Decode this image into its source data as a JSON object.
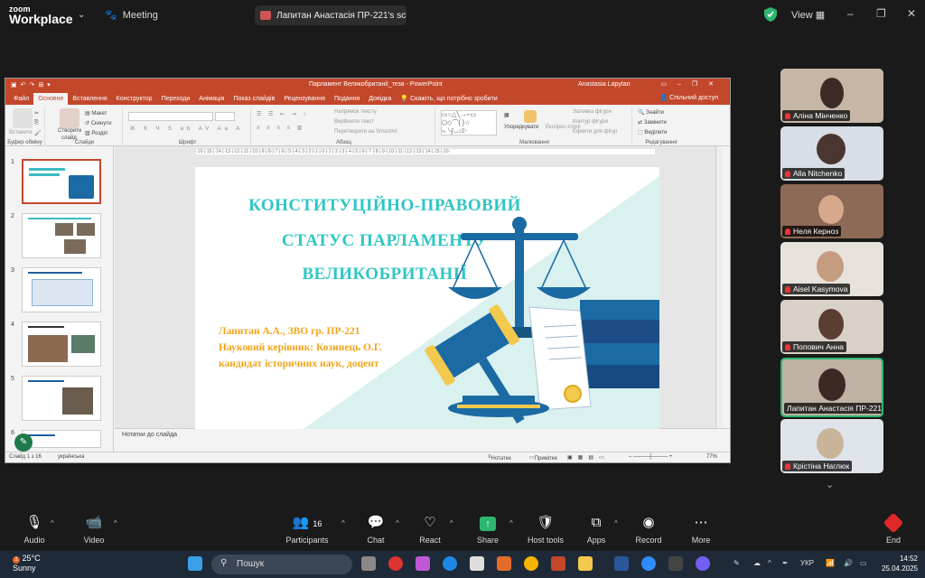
{
  "zoom": {
    "brand_line1": "zoom",
    "brand_line2": "Workplace",
    "meeting_label": "Meeting",
    "share_title": "Лапитан Анастасія ПР-221's scre",
    "view_label": "View"
  },
  "powerpoint": {
    "window_title": "Парламент Великобританії_теза - PowerPoint",
    "user": "Anastasia Lapytan",
    "tabs": [
      "Файл",
      "Основне",
      "Вставлення",
      "Конструктор",
      "Переходи",
      "Анімація",
      "Показ слайдів",
      "Рецензування",
      "Подання",
      "Довідка",
      "Скажіть, що потрібно зробити"
    ],
    "active_tab": "Основне",
    "share_label": "Спільний доступ",
    "ribbon": {
      "groups": [
        "Буфер обміну",
        "Слайди",
        "Шрифт",
        "Абзац",
        "Малювання",
        "Редагування"
      ],
      "paste": "Вставити",
      "new_slide_1": "Створити",
      "new_slide_2": "слайд",
      "layout": "Макет",
      "reset": "Скинути",
      "section": "Розділ",
      "text_direction": "Напрямок тексту",
      "align_text": "Вирівняти текст",
      "smartart": "Перетворити на SmartArt",
      "arrange": "Упорядкувати",
      "quick_styles": "Експрес-стилі",
      "shape_fill": "Заливка фігури",
      "shape_outline": "Контур фігури",
      "shape_effects": "Ефекти для фігур",
      "find": "Знайти",
      "replace": "Замінити",
      "select": "Виділити"
    },
    "slide": {
      "title_lines": [
        "КОНСТИТУЦІЙНО-ПРАВОВИЙ",
        "СТАТУС ПАРЛАМЕНТУ",
        "ВЕЛИКОБРИТАНІЇ"
      ],
      "author_lines": [
        "Лапитан А.А., ЗВО гр. ПР-221",
        "Науковий керівник: Козинець О.Г.",
        "кандидат історичних наук, доцент"
      ]
    },
    "thumbnails": [
      "1",
      "2",
      "3",
      "4",
      "5",
      "6"
    ],
    "notes_placeholder": "Нотатки до слайда",
    "status": {
      "slide": "Слайд 1 з 16",
      "language": "українська",
      "notes": "Нотатки",
      "comments": "Примітки",
      "zoom": "77%"
    }
  },
  "participants": [
    {
      "name": "Аліна Мінченко",
      "muted": true
    },
    {
      "name": "Alla Nitchenko",
      "muted": true
    },
    {
      "name": "Неля Керноз",
      "muted": true
    },
    {
      "name": "Aisel Kasymova",
      "muted": true
    },
    {
      "name": "Попович Анна",
      "muted": true
    },
    {
      "name": "Лапитан Анастасія ПР-221",
      "muted": false,
      "active": true
    },
    {
      "name": "Крістіна Наглюк",
      "muted": true
    }
  ],
  "toolbar": {
    "audio": "Audio",
    "video": "Video",
    "participants": "Participants",
    "participants_count": "16",
    "chat": "Chat",
    "react": "React",
    "share": "Share",
    "host_tools": "Host tools",
    "apps": "Apps",
    "record": "Record",
    "more": "More",
    "end": "End"
  },
  "taskbar": {
    "weather_temp": "25°C",
    "weather_desc": "Sunny",
    "weather_badge": "1",
    "search_placeholder": "Пошук",
    "language": "УКР",
    "time": "14:52",
    "date": "25.04.2025"
  },
  "colors": {
    "ppt_accent": "#c3472b",
    "slide_title": "#2fc6c3",
    "slide_author": "#f2a51c",
    "active_speaker": "#2db670"
  }
}
